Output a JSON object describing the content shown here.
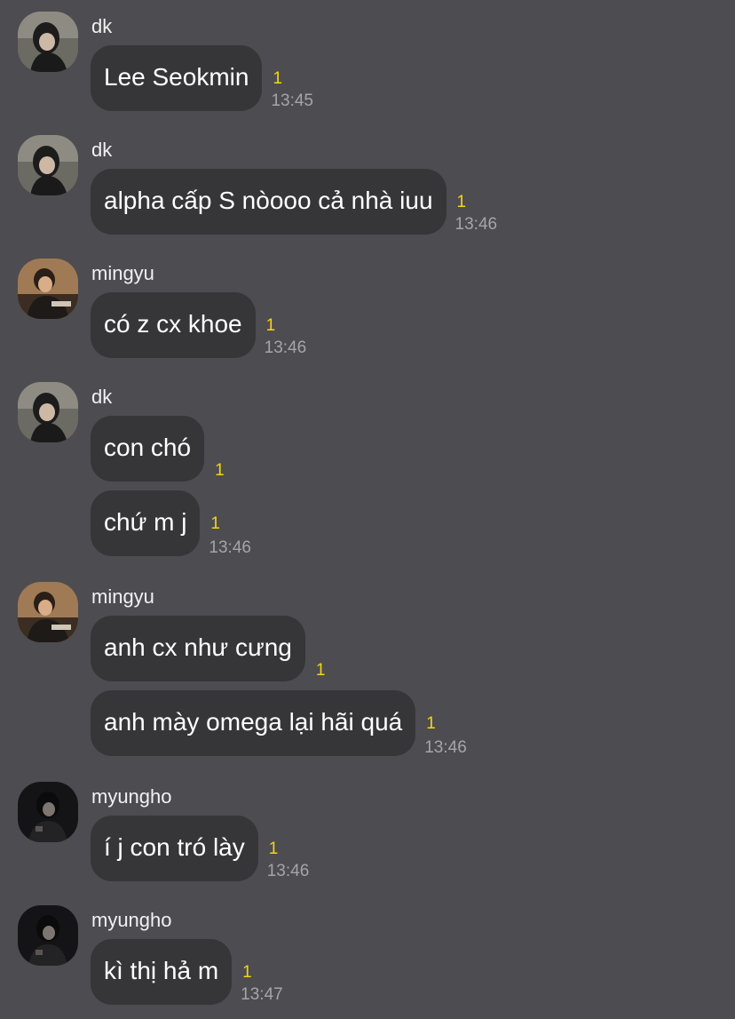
{
  "colors": {
    "background": "#4d4c51",
    "bubble": "#363538",
    "text": "#ffffff",
    "sender_name": "#f1f1f3",
    "unread_count": "#f4d417",
    "timestamp": "#a5a4a9"
  },
  "groups": [
    {
      "sender": "dk",
      "avatar": "dk-avatar",
      "messages": [
        {
          "text": "Lee Seokmin",
          "unread": "1",
          "time": "13:45"
        }
      ]
    },
    {
      "sender": "dk",
      "avatar": "dk-avatar",
      "messages": [
        {
          "text": "alpha cấp S nòooo cả nhà iuu",
          "unread": "1",
          "time": "13:46"
        }
      ]
    },
    {
      "sender": "mingyu",
      "avatar": "mingyu-avatar",
      "messages": [
        {
          "text": "có z cx khoe",
          "unread": "1",
          "time": "13:46"
        }
      ]
    },
    {
      "sender": "dk",
      "avatar": "dk-avatar",
      "messages": [
        {
          "text": "con chó",
          "unread": "1",
          "time": ""
        },
        {
          "text": "chứ m j",
          "unread": "1",
          "time": "13:46"
        }
      ]
    },
    {
      "sender": "mingyu",
      "avatar": "mingyu-avatar",
      "messages": [
        {
          "text": "anh cx như cưng",
          "unread": "1",
          "time": ""
        },
        {
          "text": "anh mày omega lại hãi quá",
          "unread": "1",
          "time": "13:46"
        }
      ]
    },
    {
      "sender": "myungho",
      "avatar": "myungho-avatar",
      "messages": [
        {
          "text": "í j con tró lày",
          "unread": "1",
          "time": "13:46"
        }
      ]
    },
    {
      "sender": "myungho",
      "avatar": "myungho-avatar",
      "messages": [
        {
          "text": "kì thị hả m",
          "unread": "1",
          "time": "13:47"
        }
      ]
    }
  ]
}
